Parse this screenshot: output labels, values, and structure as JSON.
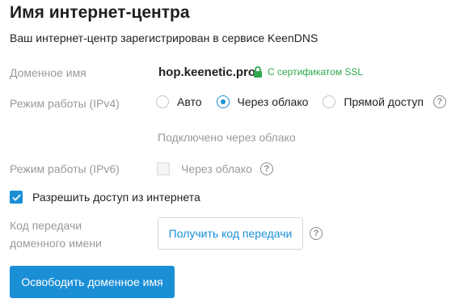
{
  "header": {
    "title": "Имя интернет-центра",
    "subtitle": "Ваш интернет-центр зарегистрирован в сервисе KeenDNS"
  },
  "domain": {
    "label": "Доменное имя",
    "value": "hop.keenetic.pro",
    "ssl_text": "С сертификатом SSL",
    "ssl_icon": "lock-icon"
  },
  "ipv4": {
    "label": "Режим работы (IPv4)",
    "options": [
      {
        "label": "Авто",
        "selected": false
      },
      {
        "label": "Через облако",
        "selected": true
      },
      {
        "label": "Прямой доступ",
        "selected": false
      }
    ],
    "help_glyph": "?",
    "status": "Подключено через облако"
  },
  "ipv6": {
    "label": "Режим работы (IPv6)",
    "checkbox_label": "Через облако",
    "checked": false,
    "disabled": true,
    "help_glyph": "?"
  },
  "internet_access": {
    "label": "Разрешить доступ из интернета",
    "checked": true
  },
  "transfer": {
    "label_line1": "Код передачи",
    "label_line2": "доменного имени",
    "button": "Получить код передачи",
    "help_glyph": "?"
  },
  "release_button": "Освободить доменное имя",
  "colors": {
    "accent": "#1b8fd6",
    "ssl_green": "#2fa84f",
    "muted": "#9a9a9a"
  }
}
